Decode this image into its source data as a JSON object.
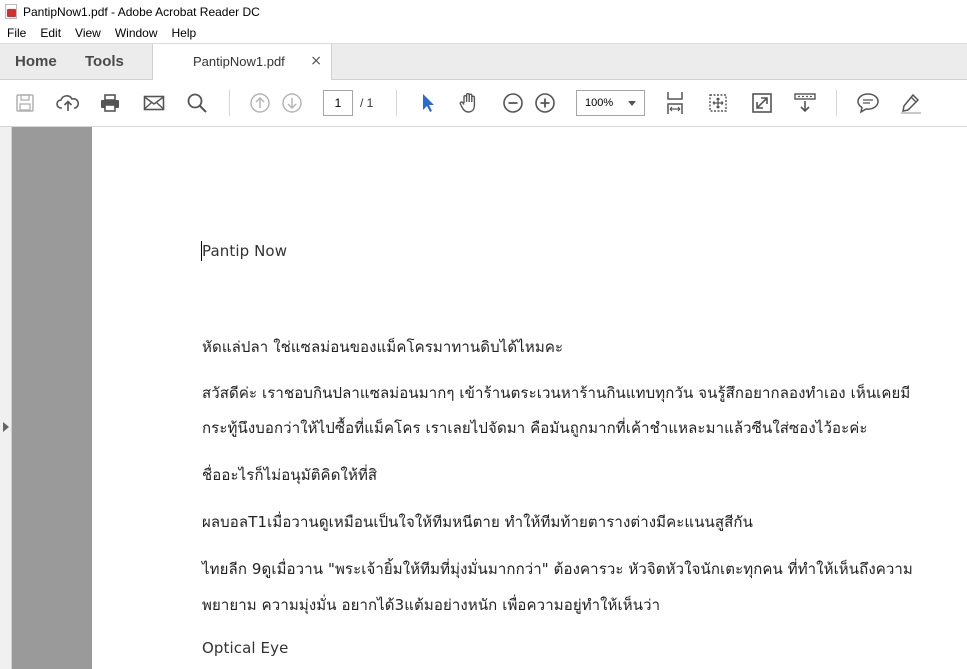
{
  "window": {
    "title": "PantipNow1.pdf - Adobe Acrobat Reader DC"
  },
  "menu": [
    "File",
    "Edit",
    "View",
    "Window",
    "Help"
  ],
  "tabs": {
    "home": "Home",
    "tools": "Tools",
    "document": "PantipNow1.pdf",
    "close": "×"
  },
  "toolbar": {
    "page_current": "1",
    "page_total": "/ 1",
    "zoom": "100%",
    "icons": [
      "save-icon",
      "upload-icon",
      "print-icon",
      "email-icon",
      "search-icon",
      "page-up-icon",
      "page-down-icon",
      "select-cursor-icon",
      "hand-icon",
      "zoom-out-icon",
      "zoom-in-icon",
      "fit-page-icon",
      "scroll-mode-icon",
      "fullscreen-icon",
      "read-mode-icon",
      "comment-icon",
      "highlight-icon"
    ],
    "accent": "#2b6bd6"
  },
  "document": {
    "lines": [
      "Pantip Now",
      "หัดแล่ปลา ใช่แซลม่อนของแม็คโครมาทานดิบได้ไหมคะ",
      "สวัสดีค่ะ เราชอบกินปลาแซลม่อนมากๆ เข้าร้านตระเวนหาร้านกินแทบทุกวัน จนรู้สึกอยากลองทำเอง เห็นเคยมี",
      "กระทู้นึงบอกว่าให้ไปซื้อที่แม็คโคร เราเลยไปจัดมา คือมันถูกมากที่เค้าชำแหละมาแล้วซีนใส่ซองไว้อะค่ะ",
      "ชื่ออะไรก็ไม่อนุมัติคิดให้ที่สิ",
      "ผลบอลT1เมื่อวานดูเหมือนเป็นใจให้ทีมหนีตาย ทำให้ทีมท้ายตารางต่างมีคะแนนสูสีกัน",
      "ไทยลีก 9ดูเมื่อวาน \"พระเจ้ายิ้มให้ทีมที่มุ่งมั่นมากกว่า\" ต้องคารวะ หัวจิตหัวใจนักเตะทุกคน ที่ทำให้เห็นถึงความ",
      "พยายาม ความมุ่งมั่น อยากได้3แต้มอย่างหนัก เพื่อความอยู่ทำให้เห็นว่า",
      "Optical Eye"
    ]
  }
}
